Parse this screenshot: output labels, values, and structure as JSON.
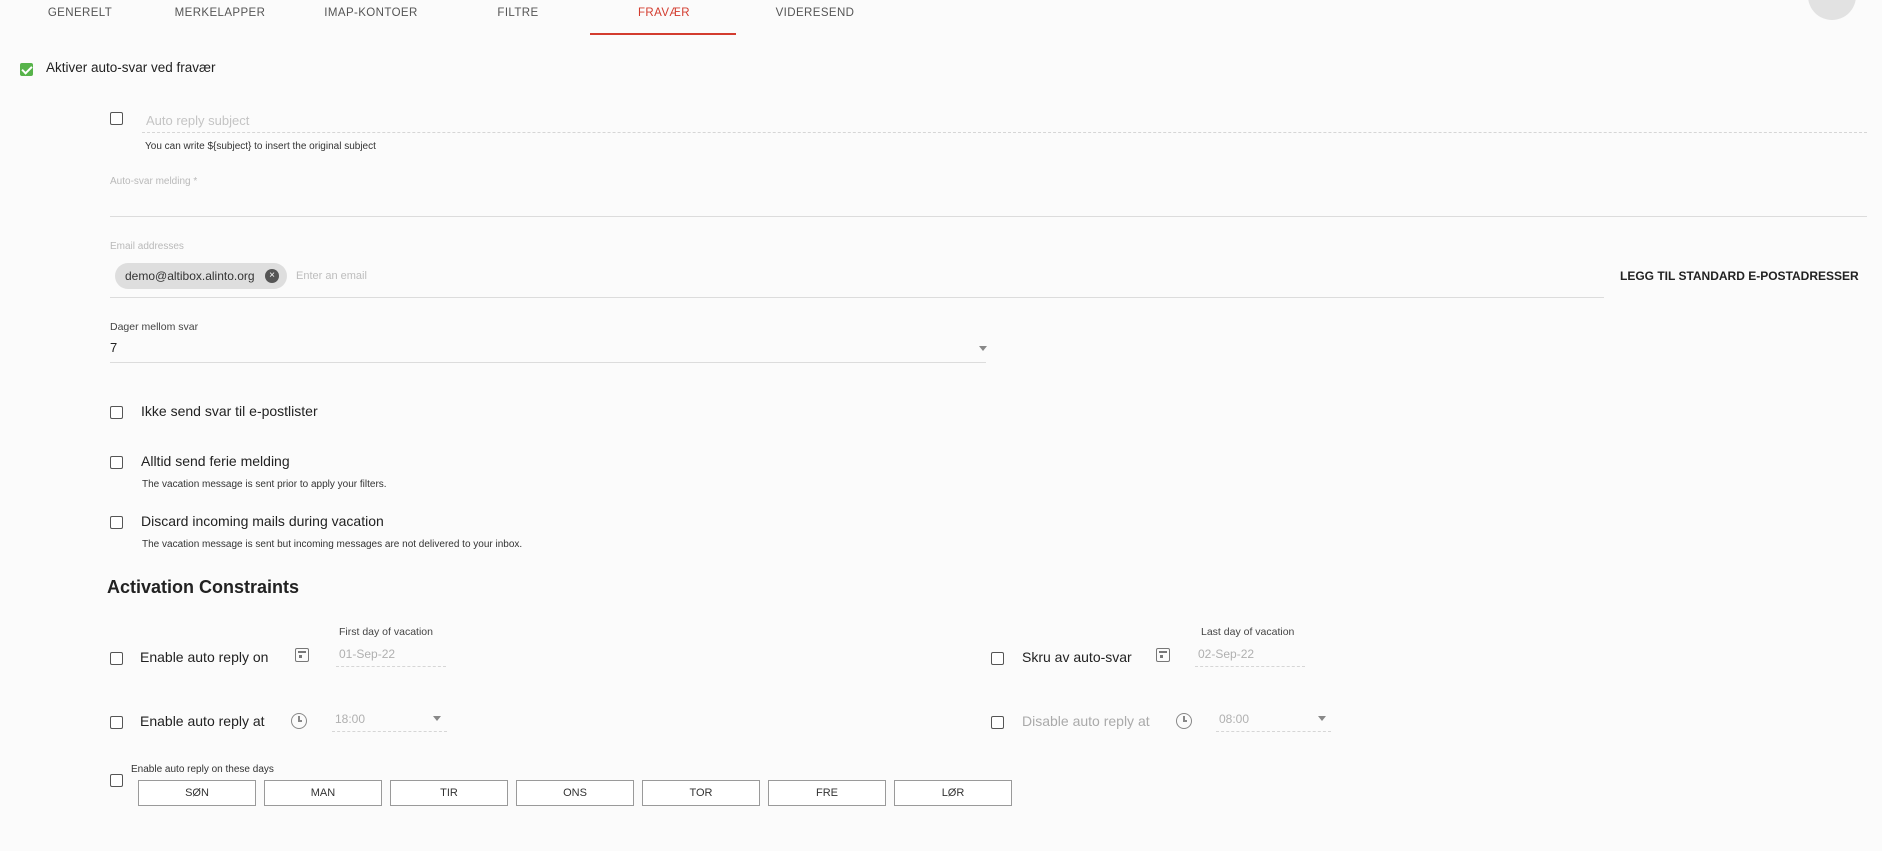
{
  "tabs": [
    "GENERELT",
    "MERKELAPPER",
    "IMAP-KONTOER",
    "FILTRE",
    "FRAVÆR",
    "VIDERESEND"
  ],
  "active_tab": "FRAVÆR",
  "enable_autoreply": {
    "label": "Aktiver auto-svar ved fravær",
    "checked": true
  },
  "subject": {
    "placeholder": "Auto reply subject",
    "hint": "You can write ${subject} to insert the original subject"
  },
  "message": {
    "label": "Auto-svar melding *"
  },
  "emails": {
    "label": "Email addresses",
    "chips": [
      "demo@altibox.alinto.org"
    ],
    "placeholder": "Enter an email",
    "add_default_button": "LEGG TIL STANDARD E-POSTADRESSER"
  },
  "days_between": {
    "label": "Dager mellom svar",
    "value": "7"
  },
  "options": [
    {
      "label": "Ikke send svar til e-postlister",
      "hint": ""
    },
    {
      "label": "Alltid send ferie melding",
      "hint": "The vacation message is sent prior to apply your filters."
    },
    {
      "label": "Discard incoming mails during vacation",
      "hint": "The vacation message is sent but incoming messages are not delivered to your inbox."
    }
  ],
  "constraints": {
    "title": "Activation Constraints",
    "start_date": {
      "label": "Enable auto reply on",
      "field_label": "First day of vacation",
      "value": "01-Sep-22"
    },
    "end_date": {
      "label": "Skru av auto-svar",
      "field_label": "Last day of vacation",
      "value": "02-Sep-22"
    },
    "start_time": {
      "label": "Enable auto reply at",
      "value": "18:00"
    },
    "end_time": {
      "label": "Disable auto reply at",
      "value": "08:00"
    },
    "days": {
      "label": "Enable auto reply on these days",
      "items": [
        "SØN",
        "MAN",
        "TIR",
        "ONS",
        "TOR",
        "FRE",
        "LØR"
      ]
    }
  },
  "colors": {
    "accent": "#d33c2f",
    "check": "#57b34a"
  }
}
